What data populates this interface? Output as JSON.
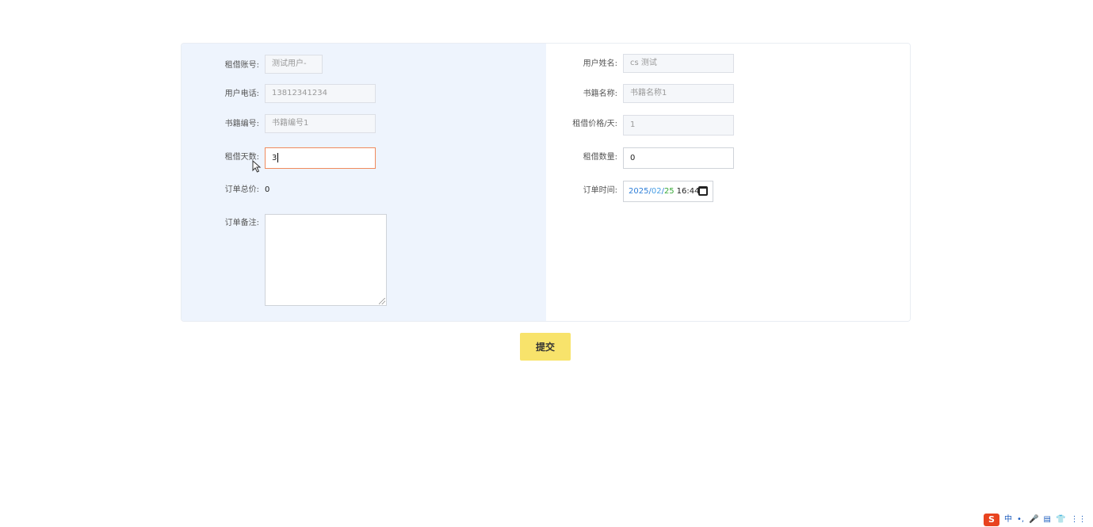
{
  "form": {
    "left": {
      "account": {
        "label": "租借账号",
        "value": "测试用户-"
      },
      "phone": {
        "label": "用户电话",
        "value": "13812341234"
      },
      "book_id": {
        "label": "书籍编号",
        "value": "书籍编号1"
      },
      "days": {
        "label": "租借天数",
        "value": "3"
      },
      "total": {
        "label": "订单总价",
        "value": "0"
      },
      "note": {
        "label": "订单备注",
        "value": ""
      }
    },
    "right": {
      "user_name": {
        "label": "用户姓名",
        "value": "cs 测试"
      },
      "book_name": {
        "label": "书籍名称",
        "value": "书籍名称1"
      },
      "price": {
        "label": "租借价格/天",
        "value": "1"
      },
      "quantity": {
        "label": "租借数量",
        "value": "0"
      },
      "order_time": {
        "label": "订单时间",
        "year": "2025",
        "month": "02",
        "day": "25",
        "time": "16:44",
        "sep": "/"
      }
    }
  },
  "actions": {
    "submit_label": "提交"
  },
  "ime": {
    "logo": "S",
    "items": [
      "中",
      "•,",
      "🎤",
      "▤",
      "👕",
      "⋮⋮",
      "⚙"
    ]
  },
  "colors": {
    "left_panel_bg": "#eef4fd",
    "submit_bg": "#f8e36b",
    "active_border": "#f08a5d"
  }
}
